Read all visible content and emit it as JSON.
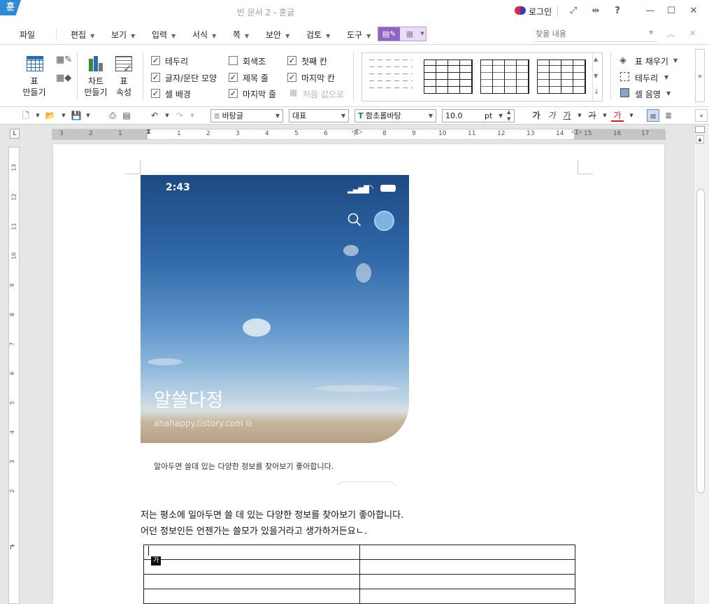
{
  "window": {
    "app_icon": "훈",
    "title": "빈 문서 2 - 훈글",
    "login_label": "로그인"
  },
  "titlebar_icons": [
    "fullscreen-icon",
    "resize-icon",
    "help-icon",
    "minimize-icon",
    "maximize-icon",
    "close-icon"
  ],
  "menu": {
    "file": "파일",
    "items": [
      "편집",
      "보기",
      "입력",
      "서식",
      "쪽",
      "보안",
      "검토",
      "도구"
    ]
  },
  "find": {
    "placeholder": "찾을 내용"
  },
  "ribbon": {
    "table_make": "표\n만들기",
    "chart_make": "차트\n만들기",
    "table_props": "표\n속성",
    "checkboxes": [
      {
        "label": "테두리",
        "checked": true
      },
      {
        "label": "글자/문단 모양",
        "checked": true
      },
      {
        "label": "셀 배경",
        "checked": true
      },
      {
        "label": "회색조",
        "checked": false
      },
      {
        "label": "제목 줄",
        "checked": true
      },
      {
        "label": "마지막 줄",
        "checked": true
      },
      {
        "label": "첫째 칸",
        "checked": true
      },
      {
        "label": "마지막 칸",
        "checked": true
      }
    ],
    "reset_label": "처음 값으로",
    "fill_label": "표 채우기",
    "border_label": "테두리",
    "shade_label": "셀 음영"
  },
  "format_bar": {
    "style": "바탕글",
    "outline": "대표",
    "font": "함초롬바탕",
    "size": "10.0",
    "unit": "pt",
    "font_glyph": "가"
  },
  "ruler": {
    "h_labels": [
      "3",
      "2",
      "1",
      "",
      "1",
      "2",
      "3",
      "4",
      "5",
      "6",
      "7",
      "8",
      "9",
      "10",
      "11",
      "12",
      "13",
      "14",
      "15",
      "16",
      "17"
    ],
    "v_labels": [
      "13",
      "12",
      "11",
      "10",
      "9",
      "8",
      "7",
      "6",
      "5",
      "4",
      "3",
      "2"
    ]
  },
  "embedded_image": {
    "time": "2:43",
    "blog_title": "알쓸다정",
    "url": "ahahappy.tistory.com",
    "description": "알아두면 쓸데 있는 다양한 정보를 찾아보기 좋아합니다."
  },
  "document": {
    "line1": "저는 평소에 일아두면 쓸 데 있는 다양한 정보를 찾아보기 좋아합니다.",
    "line2": "어던 정보인든 언젠가는 쓸모가 있을거라고 생가하거든요ㄴ.",
    "cursor_glyph": "가"
  }
}
